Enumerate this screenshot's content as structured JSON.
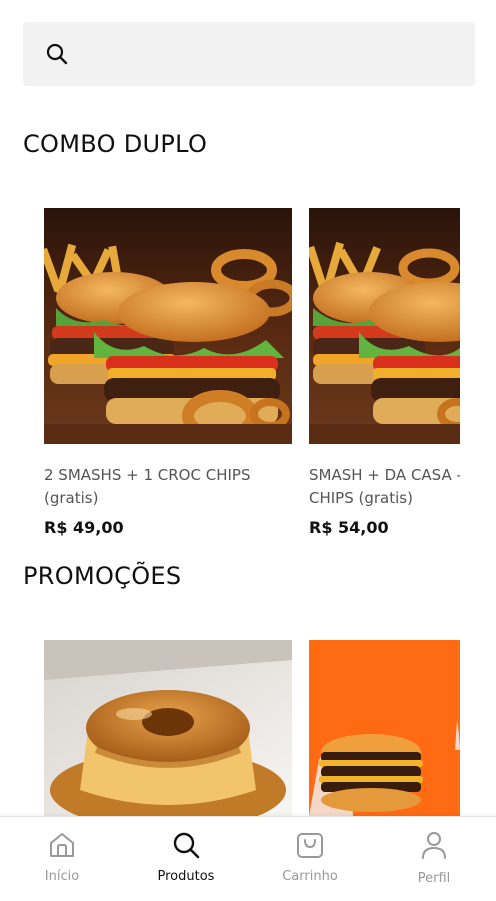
{
  "search": {
    "placeholder": "",
    "value": ""
  },
  "sections": [
    {
      "title": "COMBO DUPLO",
      "products": [
        {
          "name": "2 SMASHS + 1 CROC CHIPS (gratis)",
          "price": "R$ 49,00"
        },
        {
          "name": "SMASH + DA CASA - CHIPS (gratis)",
          "price": "R$ 54,00"
        }
      ]
    },
    {
      "title": "PROMOÇÕES",
      "products": []
    }
  ],
  "nav": {
    "items": [
      {
        "label": "Início",
        "icon": "home-icon"
      },
      {
        "label": "Produtos",
        "icon": "search-icon"
      },
      {
        "label": "Carrinho",
        "icon": "bag-icon"
      },
      {
        "label": "Perfil",
        "icon": "user-icon"
      }
    ],
    "active": "Produtos"
  },
  "colors": {
    "accent": "#ff6a13",
    "active": "#111111",
    "inactive": "#999999",
    "search_bg": "#f2f2f2"
  }
}
